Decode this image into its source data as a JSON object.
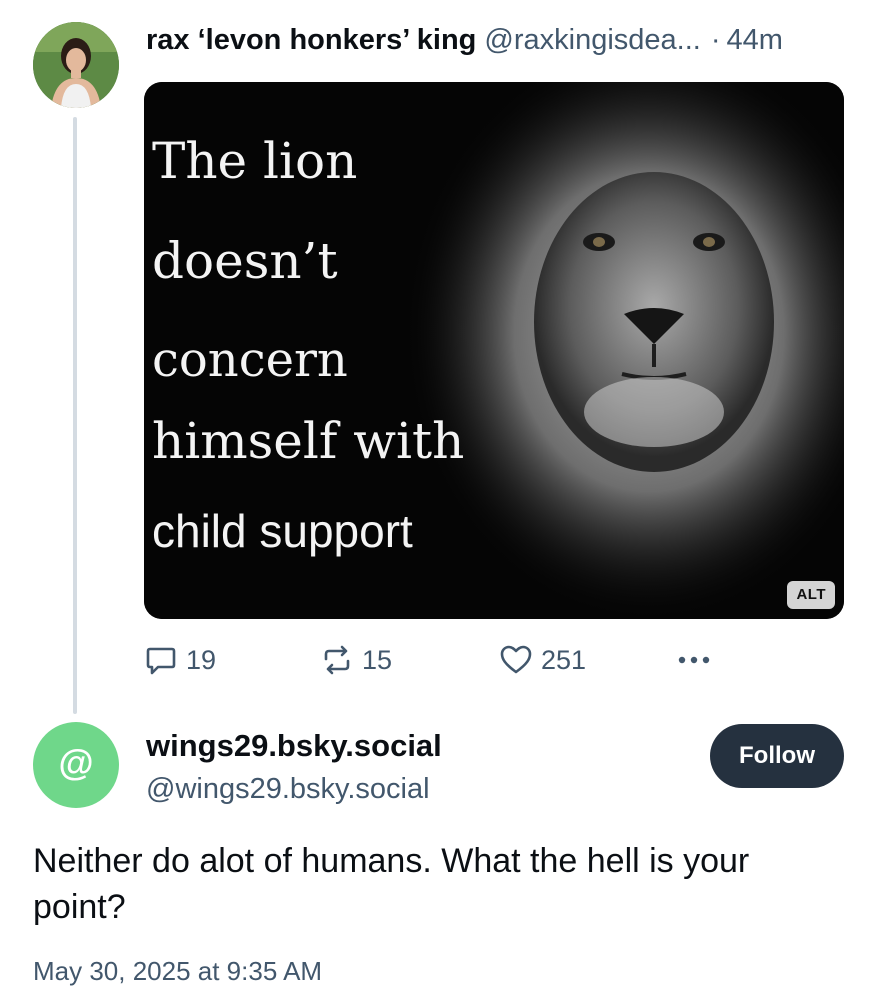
{
  "parent_post": {
    "display_name": "rax ‘levon honkers’ king",
    "handle": "@raxkingisdea...",
    "separator": "·",
    "time_ago": "44m",
    "image": {
      "meme_lines": [
        "The lion",
        "doesn’t",
        "concern",
        "himself with",
        "child support"
      ],
      "alt_label": "ALT"
    },
    "actions": {
      "replies": "19",
      "reposts": "15",
      "likes": "251"
    }
  },
  "reply_post": {
    "display_name": "wings29.bsky.social",
    "handle": "@wings29.bsky.social",
    "avatar_symbol": "@",
    "follow_label": "Follow",
    "text": "Neither do alot of humans. What the hell is your point?",
    "timestamp": "May 30, 2025 at 9:35 AM"
  },
  "colors": {
    "accent_dark": "#25313f",
    "muted_text": "#42576c",
    "reply_avatar": "#6fd78a",
    "thread_line": "#d4dbe2"
  },
  "icons": [
    "reply-icon",
    "repost-icon",
    "heart-icon",
    "more-icon"
  ]
}
